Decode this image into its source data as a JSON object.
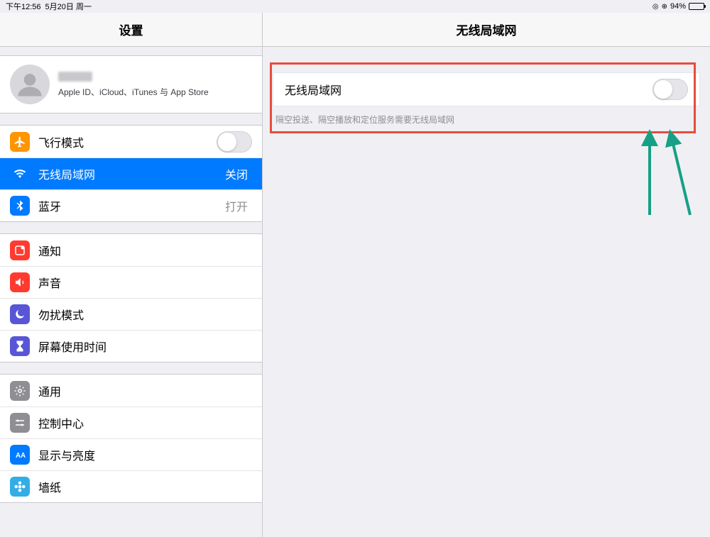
{
  "statusbar": {
    "time": "下午12:56",
    "date": "5月20日 周一",
    "battery_pct": "94%",
    "alarm_glyph": "◎",
    "lock_glyph": "⊕"
  },
  "sidebar": {
    "title": "设置",
    "profile": {
      "subtitle": "Apple ID、iCloud、iTunes 与 App Store"
    },
    "groups": [
      {
        "rows": [
          {
            "id": "airplane-mode",
            "label": "飞行模式",
            "type": "toggle",
            "icon": "airplane",
            "iconColor": "orange"
          },
          {
            "id": "wifi",
            "label": "无线局域网",
            "value": "关闭",
            "icon": "wifi",
            "iconColor": "blue",
            "selected": true
          },
          {
            "id": "bluetooth",
            "label": "蓝牙",
            "value": "打开",
            "icon": "bluetooth",
            "iconColor": "blue"
          }
        ]
      },
      {
        "rows": [
          {
            "id": "notifications",
            "label": "通知",
            "icon": "square",
            "iconColor": "red"
          },
          {
            "id": "sounds",
            "label": "声音",
            "icon": "speaker",
            "iconColor": "red"
          },
          {
            "id": "dnd",
            "label": "勿扰模式",
            "icon": "moon",
            "iconColor": "purple"
          },
          {
            "id": "screentime",
            "label": "屏幕使用时间",
            "icon": "hourglass",
            "iconColor": "purple"
          }
        ]
      },
      {
        "rows": [
          {
            "id": "general",
            "label": "通用",
            "icon": "gear",
            "iconColor": "grey"
          },
          {
            "id": "control-center",
            "label": "控制中心",
            "icon": "sliders",
            "iconColor": "grey"
          },
          {
            "id": "display",
            "label": "显示与亮度",
            "icon": "aa",
            "iconColor": "blue"
          },
          {
            "id": "wallpaper",
            "label": "墙纸",
            "icon": "flower",
            "iconColor": "ltblue"
          }
        ]
      }
    ]
  },
  "detail": {
    "title": "无线局域网",
    "wifi_row_label": "无线局域网",
    "wifi_footer": "隔空投送、隔空播放和定位服务需要无线局域网"
  },
  "annotation": {
    "highlight_color": "#e74c3c",
    "arrow_color": "#16a085"
  }
}
